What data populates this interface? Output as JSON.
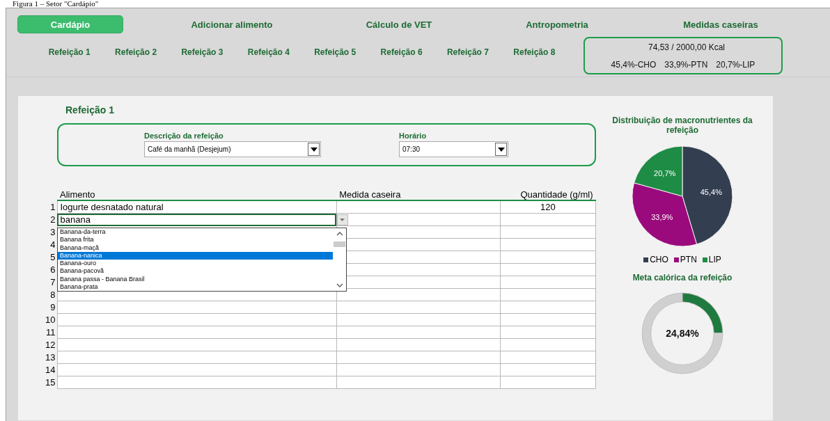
{
  "caption": "Figura 1 – Setor \"Cardápio\"",
  "nav": [
    {
      "label": "Cardápio",
      "selected": true
    },
    {
      "label": "Adicionar alimento",
      "selected": false
    },
    {
      "label": "Cálculo de VET",
      "selected": false
    },
    {
      "label": "Antropometria",
      "selected": false
    },
    {
      "label": "Medidas caseiras",
      "selected": false
    }
  ],
  "meals": [
    "Refeição 1",
    "Refeição 2",
    "Refeição 3",
    "Refeição 4",
    "Refeição 5",
    "Refeição 6",
    "Refeição 7",
    "Refeição 8"
  ],
  "summary": {
    "kcal": "74,53 / 2000,00 Kcal",
    "macros": [
      "45,4%-CHO",
      "33,9%-PTN",
      "20,7%-LIP"
    ]
  },
  "meal_title": "Refeição 1",
  "description": {
    "label": "Descrição da refeição",
    "value": "Café da manhã (Desjejum)"
  },
  "time": {
    "label": "Horário",
    "value": "07:30"
  },
  "table": {
    "columns": [
      "Alimento",
      "Medida caseira",
      "Quantidade (g/ml)"
    ],
    "rows": [
      {
        "number": "1",
        "food": "Iogurte desnatado natural",
        "measure": "",
        "quantity": "120",
        "editing": false
      },
      {
        "number": "2",
        "food": "banana",
        "measure": "",
        "quantity": "",
        "editing": true
      },
      {
        "number": "3",
        "food": "",
        "measure": "",
        "quantity": "",
        "editing": false
      },
      {
        "number": "4",
        "food": "",
        "measure": "",
        "quantity": "",
        "editing": false
      },
      {
        "number": "5",
        "food": "",
        "measure": "",
        "quantity": "",
        "editing": false
      },
      {
        "number": "6",
        "food": "",
        "measure": "",
        "quantity": "",
        "editing": false
      },
      {
        "number": "7",
        "food": "",
        "measure": "",
        "quantity": "",
        "editing": false
      },
      {
        "number": "8",
        "food": "",
        "measure": "",
        "quantity": "",
        "editing": false
      },
      {
        "number": "9",
        "food": "",
        "measure": "",
        "quantity": "",
        "editing": false
      },
      {
        "number": "10",
        "food": "",
        "measure": "",
        "quantity": "",
        "editing": false
      },
      {
        "number": "11",
        "food": "",
        "measure": "",
        "quantity": "",
        "editing": false
      },
      {
        "number": "12",
        "food": "",
        "measure": "",
        "quantity": "",
        "editing": false
      },
      {
        "number": "13",
        "food": "",
        "measure": "",
        "quantity": "",
        "editing": false
      },
      {
        "number": "14",
        "food": "",
        "measure": "",
        "quantity": "",
        "editing": false
      },
      {
        "number": "15",
        "food": "",
        "measure": "",
        "quantity": "",
        "editing": false
      }
    ],
    "dropdown": [
      {
        "label": "Banana-da-terra",
        "selected": false
      },
      {
        "label": "Banana frita",
        "selected": false
      },
      {
        "label": "Banana-maçã",
        "selected": false
      },
      {
        "label": "Banana-nanica",
        "selected": true
      },
      {
        "label": "Banana-ouro",
        "selected": false
      },
      {
        "label": "Banana-pacovã",
        "selected": false
      },
      {
        "label": "Banana passa - Banana Brasil",
        "selected": false
      },
      {
        "label": "Banana-prata",
        "selected": false
      }
    ]
  },
  "macro_chart": {
    "chart_data": {
      "type": "pie",
      "title": "Distribuição de macronutrientes da refeição",
      "categories": [
        "CHO",
        "PTN",
        "LIP"
      ],
      "values": [
        45.4,
        33.9,
        20.7
      ],
      "colors": [
        "#333f50",
        "#9b0a7d",
        "#1e8c44"
      ],
      "value_labels": [
        "45,4%",
        "33,9%",
        "20,7%"
      ],
      "legend": "bottom"
    }
  },
  "goal_chart": {
    "chart_data": {
      "type": "donut",
      "title": "Meta calórica da refeição",
      "values": [
        24.84,
        75.16
      ],
      "colors": [
        "#1e7a3e",
        "#d0d0d0"
      ],
      "annotations": [
        "24,84%"
      ]
    }
  }
}
